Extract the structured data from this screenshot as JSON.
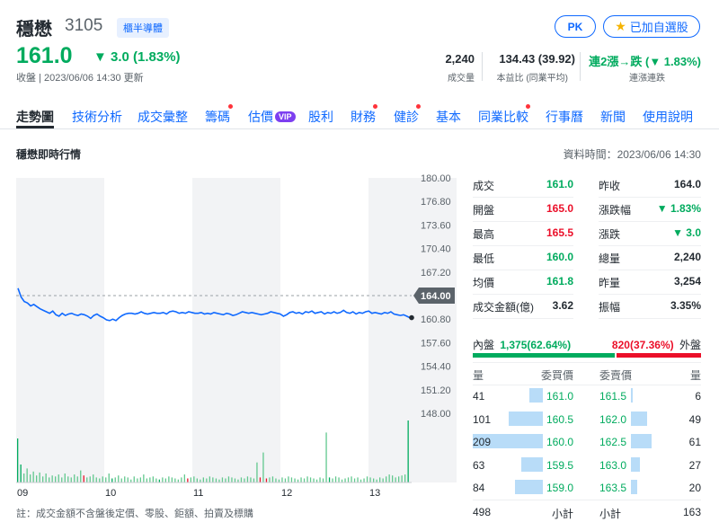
{
  "header": {
    "name": "穩懋",
    "code": "3105",
    "badge": "櫃半導體",
    "pk_label": "PK",
    "watchlist_label": "已加自選股",
    "price": "161.0",
    "change": "▼ 3.0 (1.83%)",
    "status": "收盤 | 2023/06/06 14:30 更新"
  },
  "stats": [
    {
      "value": "2,240",
      "label": "成交量",
      "color": "#232a31"
    },
    {
      "value": "134.43 (39.92)",
      "label": "本益比 (同業平均)",
      "color": "#232a31"
    },
    {
      "value": "連2漲→跌 (▼ 1.83%)",
      "label": "連漲連跌",
      "color": "#00ab5e"
    }
  ],
  "tabs": [
    {
      "label": "走勢圖",
      "active": true,
      "dot": false
    },
    {
      "label": "技術分析",
      "dot": false
    },
    {
      "label": "成交彙整",
      "dot": false
    },
    {
      "label": "籌碼",
      "dot": true
    },
    {
      "label": "估價",
      "dot": false,
      "vip": "VIP"
    },
    {
      "label": "股利",
      "dot": false
    },
    {
      "label": "財務",
      "dot": true
    },
    {
      "label": "健診",
      "dot": true
    },
    {
      "label": "基本",
      "dot": false
    },
    {
      "label": "同業比較",
      "dot": true
    },
    {
      "label": "行事曆",
      "dot": false
    },
    {
      "label": "新聞",
      "dot": false
    },
    {
      "label": "使用說明",
      "dot": false
    }
  ],
  "section": {
    "title": "穩懋即時行情",
    "data_time": "資料時間：2023/06/06 14:30"
  },
  "chart_data": {
    "type": "line",
    "y_ticks": [
      "180.00",
      "176.80",
      "173.60",
      "170.40",
      "167.20",
      "164.00",
      "160.80",
      "157.60",
      "154.40",
      "151.20",
      "148.00"
    ],
    "ylim": [
      148.0,
      180.0
    ],
    "prev_close": 164.0,
    "prev_close_label": "164.00",
    "x_ticks": [
      "09",
      "10",
      "11",
      "12",
      "13"
    ],
    "price_series": [
      165.0,
      163.8,
      163.2,
      163.0,
      162.6,
      162.8,
      162.5,
      162.2,
      162.0,
      161.8,
      161.6,
      161.9,
      161.4,
      161.2,
      161.6,
      161.3,
      161.5,
      161.6,
      161.4,
      161.3,
      161.5,
      161.4,
      161.2,
      160.9,
      161.3,
      161.5,
      161.2,
      161.0,
      160.7,
      160.6,
      160.8,
      160.6,
      161.0,
      161.3,
      161.5,
      161.6,
      161.6,
      161.5,
      161.6,
      161.8,
      161.6,
      161.5,
      161.6,
      161.7,
      161.6,
      161.6,
      161.7,
      161.5,
      161.8,
      161.9,
      161.8,
      161.6,
      161.7,
      161.6,
      161.8,
      161.7,
      161.6,
      161.6,
      161.7,
      161.5,
      161.6,
      161.5,
      161.7,
      161.6,
      161.5,
      161.4,
      161.6,
      161.5,
      161.3,
      161.4,
      161.6,
      161.8,
      161.7,
      161.6,
      161.7,
      161.6,
      161.5,
      161.4,
      161.5,
      161.6,
      161.8,
      161.7,
      161.6,
      161.5,
      161.2,
      161.4,
      161.7,
      161.8,
      161.6,
      161.7,
      161.5,
      161.8,
      161.7,
      161.9,
      161.6,
      161.7,
      161.8,
      161.5,
      161.7,
      161.6,
      161.8,
      161.6,
      161.7,
      162.0,
      161.7,
      161.6,
      161.8,
      161.5,
      161.7,
      161.6,
      161.8,
      161.9,
      161.6,
      161.7,
      161.6,
      161.5,
      161.7,
      161.6,
      161.8,
      161.5,
      161.4,
      161.3,
      161.4,
      161.2,
      161.0
    ],
    "volume_series": [
      44,
      18,
      9,
      14,
      8,
      11,
      7,
      10,
      6,
      9,
      5,
      7,
      6,
      8,
      5,
      9,
      6,
      5,
      8,
      6,
      12,
      7,
      5,
      6,
      8,
      5,
      4,
      6,
      5,
      9,
      4,
      5,
      7,
      4,
      6,
      5,
      3,
      6,
      4,
      5,
      8,
      4,
      5,
      6,
      4,
      3,
      5,
      4,
      6,
      5,
      4,
      3,
      5,
      8,
      4,
      5,
      6,
      4,
      3,
      5,
      4,
      6,
      5,
      4,
      3,
      5,
      4,
      6,
      5,
      4,
      3,
      5,
      4,
      6,
      5,
      4,
      20,
      5,
      30,
      4,
      5,
      6,
      4,
      3,
      5,
      4,
      6,
      5,
      4,
      3,
      5,
      4,
      6,
      5,
      4,
      3,
      5,
      4,
      50,
      5,
      4,
      6,
      5,
      3,
      4,
      5,
      6,
      4,
      5,
      3,
      4,
      6,
      5,
      4,
      3,
      5,
      4,
      6,
      8,
      7,
      5,
      6,
      7,
      8,
      62
    ],
    "volume_up_indices": [
      21,
      54,
      77,
      79
    ],
    "volume_down_indices": [
      0,
      1,
      30,
      45,
      99,
      124
    ]
  },
  "quote": {
    "left": [
      {
        "label": "成交",
        "value": "161.0",
        "color": "#00ab5e"
      },
      {
        "label": "開盤",
        "value": "165.0",
        "color": "#eb0f29"
      },
      {
        "label": "最高",
        "value": "165.5",
        "color": "#eb0f29"
      },
      {
        "label": "最低",
        "value": "160.0",
        "color": "#00ab5e"
      },
      {
        "label": "均價",
        "value": "161.8",
        "color": "#00ab5e"
      },
      {
        "label": "成交金額(億)",
        "value": "3.62",
        "color": "#232a31"
      }
    ],
    "right": [
      {
        "label": "昨收",
        "value": "164.0",
        "color": "#232a31"
      },
      {
        "label": "漲跌幅",
        "value": "▼ 1.83%",
        "color": "#00ab5e"
      },
      {
        "label": "漲跌",
        "value": "▼ 3.0",
        "color": "#00ab5e"
      },
      {
        "label": "總量",
        "value": "2,240",
        "color": "#232a31"
      },
      {
        "label": "昨量",
        "value": "3,254",
        "color": "#232a31"
      },
      {
        "label": "振幅",
        "value": "3.35%",
        "color": "#232a31"
      }
    ]
  },
  "inner_outer": {
    "inner_label": "內盤",
    "inner_value": "1,375(62.64%)",
    "outer_value": "820(37.36%)",
    "outer_label": "外盤",
    "inner_fraction": 0.6264
  },
  "orderbook": {
    "headers": [
      "量",
      "委買價",
      "委賣價",
      "量"
    ],
    "max_volume": 209,
    "rows": [
      {
        "bid_vol": "41",
        "bid_vol_n": 41,
        "bid": "161.0",
        "ask": "161.5",
        "ask_vol": "6",
        "ask_vol_n": 6
      },
      {
        "bid_vol": "101",
        "bid_vol_n": 101,
        "bid": "160.5",
        "ask": "162.0",
        "ask_vol": "49",
        "ask_vol_n": 49
      },
      {
        "bid_vol": "209",
        "bid_vol_n": 209,
        "bid": "160.0",
        "ask": "162.5",
        "ask_vol": "61",
        "ask_vol_n": 61
      },
      {
        "bid_vol": "63",
        "bid_vol_n": 63,
        "bid": "159.5",
        "ask": "163.0",
        "ask_vol": "27",
        "ask_vol_n": 27
      },
      {
        "bid_vol": "84",
        "bid_vol_n": 84,
        "bid": "159.0",
        "ask": "163.5",
        "ask_vol": "20",
        "ask_vol_n": 20
      }
    ],
    "bid_total": "498",
    "bid_total_label": "小計",
    "ask_total_label": "小計",
    "ask_total": "163"
  },
  "footnote": "註：成交金額不含盤後定價、零股、鉅額、拍賣及標購"
}
